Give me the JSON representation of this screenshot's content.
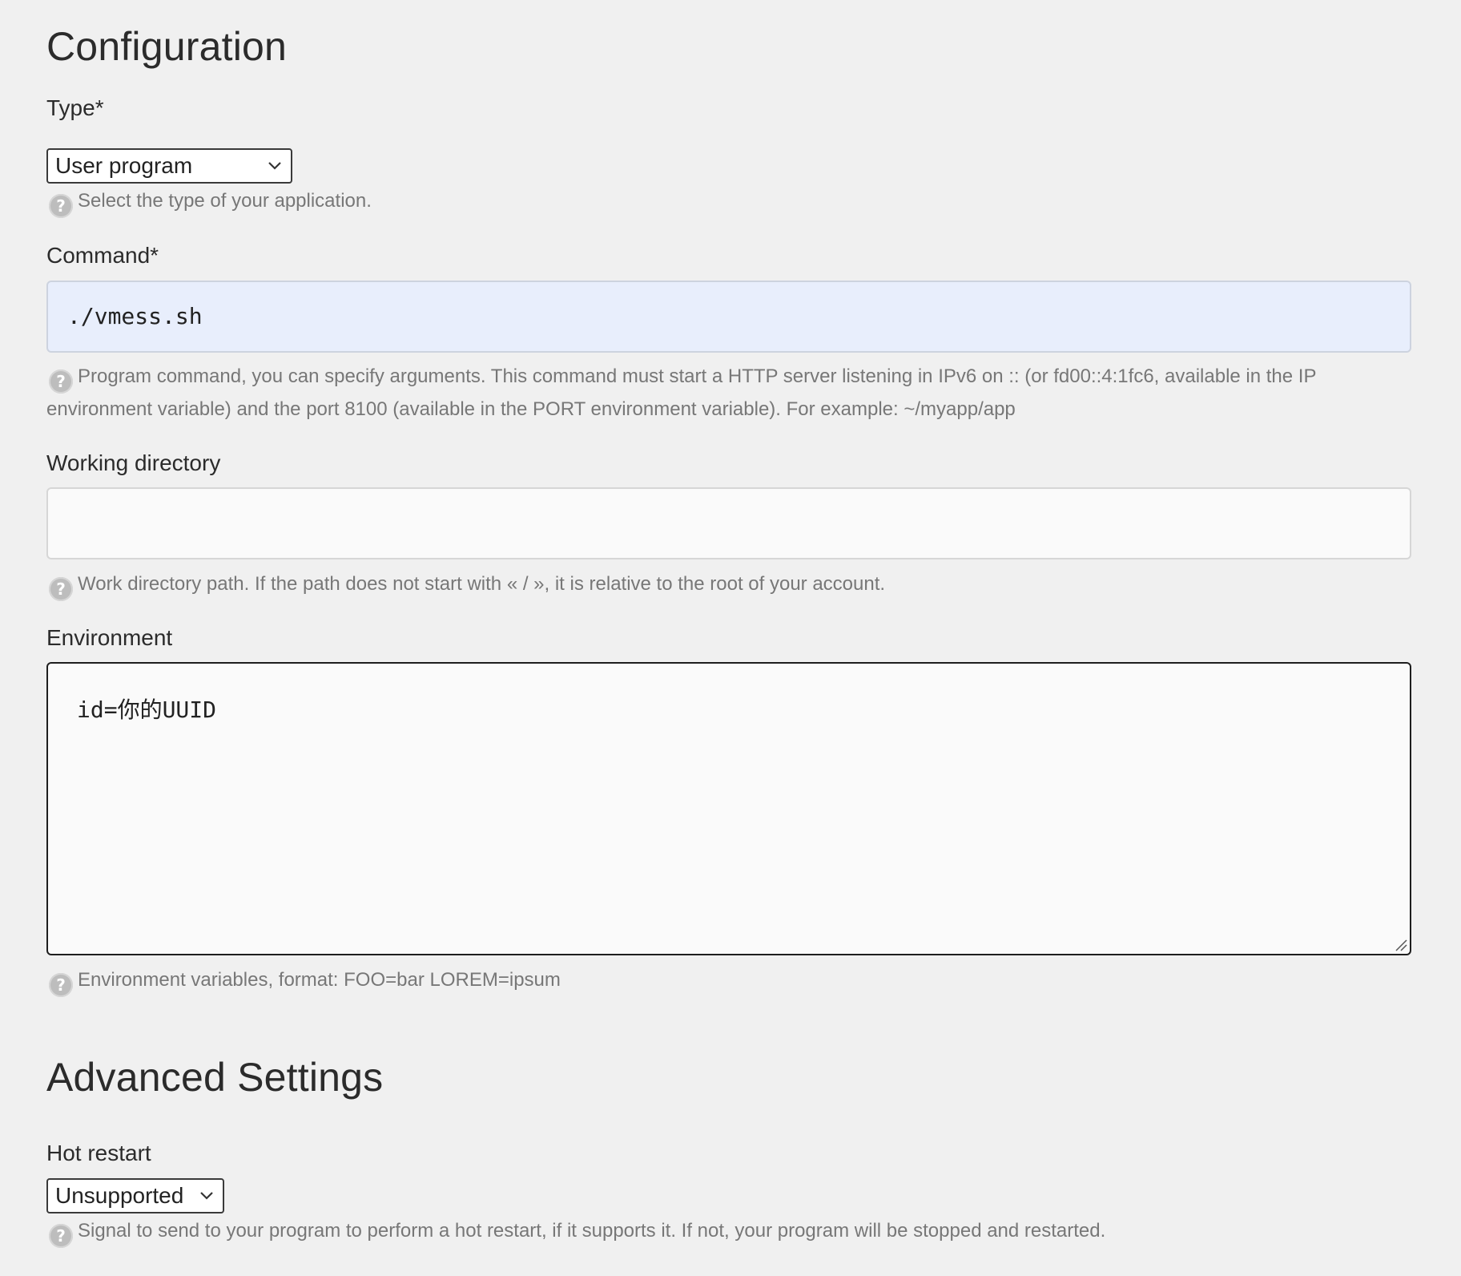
{
  "configuration": {
    "title": "Configuration",
    "type": {
      "label": "Type*",
      "value": "User program",
      "help": "Select the type of your application."
    },
    "command": {
      "label": "Command*",
      "value": "./vmess.sh",
      "help": "Program command, you can specify arguments. This command must start a HTTP server listening in IPv6 on :: (or fd00::4:1fc6, available in the IP environment variable) and the port 8100 (available in the PORT environment variable). For example: ~/myapp/app"
    },
    "working_directory": {
      "label": "Working directory",
      "value": "",
      "help": "Work directory path. If the path does not start with « / », it is relative to the root of your account."
    },
    "environment": {
      "label": "Environment",
      "value": "id=你的UUID",
      "help": "Environment variables, format: FOO=bar LOREM=ipsum"
    }
  },
  "advanced": {
    "title": "Advanced Settings",
    "hot_restart": {
      "label": "Hot restart",
      "value": "Unsupported",
      "help": "Signal to send to your program to perform a hot restart, if it supports it. If not, your program will be stopped and restarted."
    }
  },
  "icons": {
    "help": "question-circle-icon",
    "dropdown": "chevron-down-icon",
    "resize": "resize-grip-icon"
  },
  "colors": {
    "background": "#f0f0f0",
    "command_fill": "#e8eefc",
    "help_text": "#777777",
    "help_icon": "#bdbdbd"
  }
}
